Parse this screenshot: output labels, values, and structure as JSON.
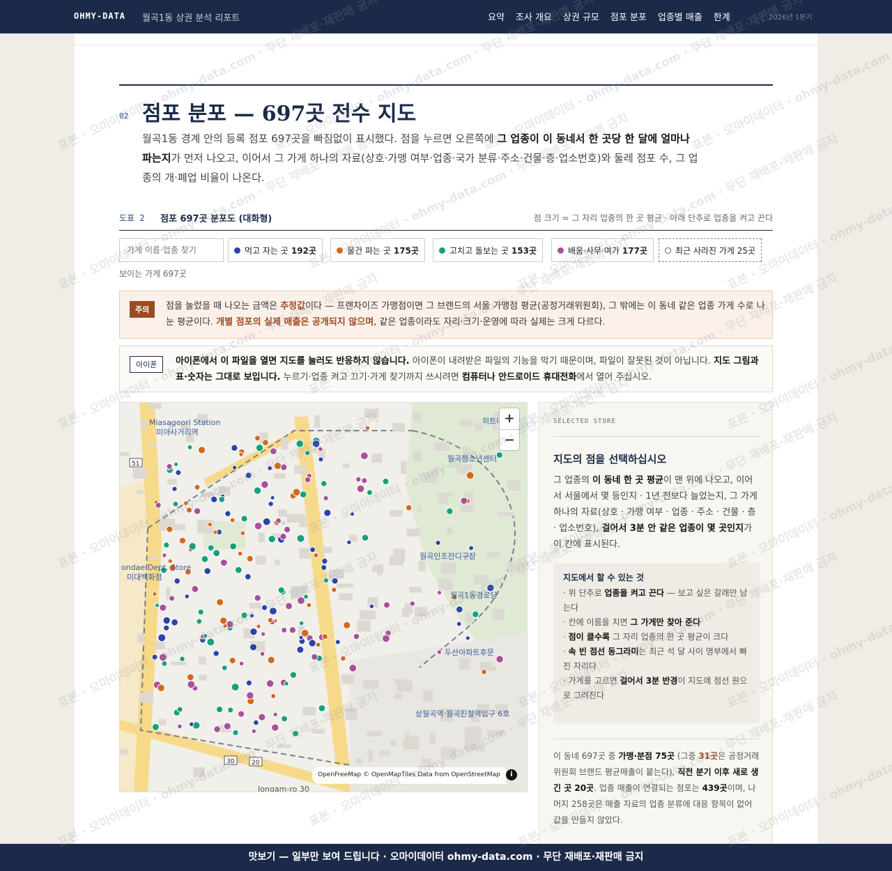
{
  "header": {
    "brand": "OHMY-DATA",
    "doc_title": "월곡1동 상권 분석 리포트",
    "nav": [
      "요약",
      "조사 개요",
      "상권 규모",
      "점포 분포",
      "업종별 매출",
      "한계"
    ],
    "period": "2026년 1분기"
  },
  "section": {
    "number": "02",
    "title": "점포 분포 — 697곳 전수 지도",
    "lead_1": "월곡1동 경계 안의 등록 점포 697곳을 빠짐없이 표시했다. 점을 누르면 오른쪽에 ",
    "lead_bold": "그 업종이 이 동네서 한 곳당 한 달에 얼마나 파는지",
    "lead_2": "가 먼저 나오고, 이어서 그 가게 하나의 자료(상호·가맹 여부·업종·국가 분류·주소·건물·층·업소번호)와 둘레 점포 수, 그 업종의 개·폐업 비율이 나온다."
  },
  "figure": {
    "label": "도표 2",
    "title": "점포 697곳 분포도 (대화형)",
    "note": "점 크기 = 그 자리 업종의 한 곳 평균 · 아래 단추로 업종을 켜고 끈다"
  },
  "filters": {
    "search_placeholder": "가게 이름·업종 찾기",
    "chips": [
      {
        "label": "먹고 자는 곳",
        "count": "192곳",
        "color": "#2a44a8"
      },
      {
        "label": "물건 파는 곳",
        "count": "175곳",
        "color": "#d2691e"
      },
      {
        "label": "고치고 돌보는 곳",
        "count": "153곳",
        "color": "#17a07a"
      },
      {
        "label": "배움·사무·여가",
        "count": "177곳",
        "color": "#a8509c"
      }
    ],
    "closed_chip": {
      "label": "최근 사라진 가게",
      "count": "25곳"
    },
    "visible_count": "보이는 가게 697곳"
  },
  "warning": {
    "tag": "주의",
    "t1": "점을 눌렀을 때 나오는 금액은 ",
    "b1": "추정값",
    "t2": "이다 — 프랜차이즈 가맹점이면 그 브랜드의 서울 가맹점 평균(공정거래위원회), 그 밖에는 이 동네 같은 업종 가게 수로 나눈 평균이다. ",
    "b2": "개별 점포의 실제 매출은 공개되지 않으며",
    "t3": ", 같은 업종이라도 자리·크기·운영에 따라 실제는 크게 다르다."
  },
  "iphone": {
    "tag": "아이폰",
    "b1": "아이폰에서 이 파일을 열면 지도를 눌러도 반응하지 않습니다.",
    "t1": " 아이폰이 내려받은 파일의 기능을 막기 때문이며, 파일이 잘못된 것이 아닙니다. ",
    "b2": "지도 그림과 표·숫자는 그대로 보입니다.",
    "t2": " 누르기·업종 켜고 끄기·가게 찾기까지 쓰시려면 ",
    "b3": "컴퓨터나 안드로이드 휴대전화",
    "t3": "에서 열어 주십시오."
  },
  "map": {
    "attribution": "OpenFreeMap © OpenMapTiles Data from OpenStreetMap",
    "zoom_in": "+",
    "zoom_out": "−",
    "info": "i",
    "labels": {
      "station_en": "Miasageori Station",
      "station_ko": "미아사거리역",
      "dept_en": "ondae Dept. Store",
      "dept_ko": "미대백화점",
      "youth": "월곡청소년센터",
      "grass": "월곡인조잔디구장",
      "senior": "월곡1동경로당",
      "doosan": "두산아파트후문",
      "subway": "상월곡역·월곡진철역입구 6호",
      "jongam": "Jongam-ro 30",
      "hitl": "히트니",
      "r51": "51",
      "r30": "30",
      "r20": "20"
    }
  },
  "side": {
    "kicker": "SELECTED STORE",
    "title": "지도의 점을 선택하십시오",
    "body_1": "그 업종의 ",
    "body_b1": "이 동네 한 곳 평균",
    "body_2": "이 맨 위에 나오고, 이어서 서울에서 몇 등인지 · 1년 전보다 늘었는지, 그 가게 하나의 자료(상호 · 가맹 여부 · 업종 · 주소 · 건물 · 층 · 업소번호), ",
    "body_b2": "걸어서 3분 안 같은 업종이 몇 곳인지",
    "body_3": "가 이 칸에 표시된다.",
    "help_title": "지도에서 할 수 있는 것",
    "help": [
      {
        "t1": "· 위 단추로 ",
        "b": "업종을 켜고 끈다",
        "t2": " — 보고 싶은 갈래만 남는다"
      },
      {
        "t1": "· 칸에 이름을 치면 ",
        "b": "그 가게만 찾아 준다",
        "t2": ""
      },
      {
        "t1": "· ",
        "b": "점이 클수록",
        "t2": " 그 자리 업종의 한 곳 평균이 크다"
      },
      {
        "t1": "· ",
        "b": "속 빈 점선 동그라미",
        "t2": "는 최근 석 달 사이 명부에서 빠진 자리다"
      },
      {
        "t1": "· 가게를 고르면 ",
        "b": "걸어서 3분 반경",
        "t2": "이 지도에 점선 원으로 그려진다"
      }
    ],
    "stats_1": "이 동네 697곳 중 ",
    "stats_b1": "가맹·분점 75곳",
    "stats_2": " (그중 ",
    "stats_b2": "31곳",
    "stats_3": "은 공정거래위원회 브랜드 평균매출이 붙는다), ",
    "stats_b3": "직전 분기 이후 새로 생긴 곳 20곳",
    "stats_4": ". 업종 매출이 연결되는 점포는 ",
    "stats_b4": "439곳",
    "stats_5": "이며, 나머지 258곳은 매출 자료의 업종 분류에 대응 항목이 없어 값을 만들지 않았다."
  },
  "footer": "맛보기 — 일부만 보여 드립니다 · 오마이데이터 ohmy-data.com · 무단 재배포·재판매 금지",
  "watermark": "표본 · 오마이데이터 · ohmy-data.com · 무단 재배포·재판매 금지"
}
